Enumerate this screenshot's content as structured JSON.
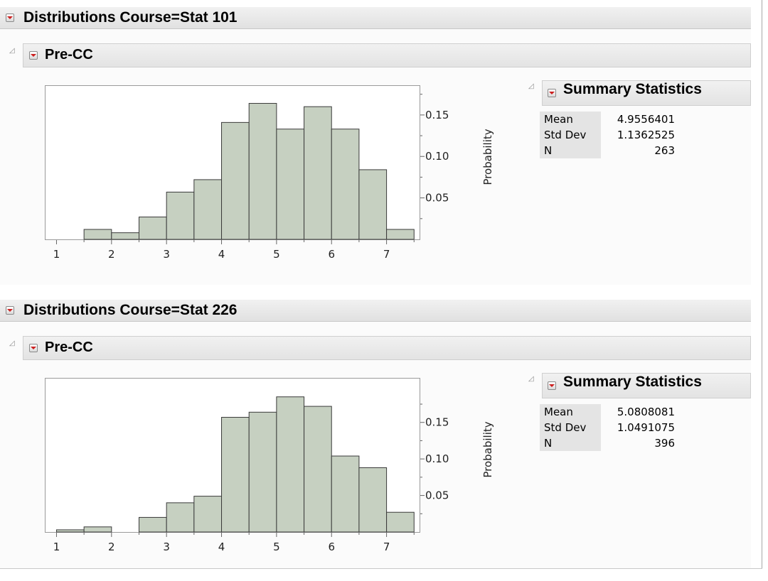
{
  "reports": [
    {
      "title": "Distributions Course=Stat 101",
      "variable": "Pre-CC",
      "summary_title": "Summary Statistics",
      "stats": [
        {
          "label": "Mean",
          "value": "4.9556401"
        },
        {
          "label": "Std Dev",
          "value": "1.1362525"
        },
        {
          "label": "N",
          "value": "263"
        }
      ],
      "chart_data": {
        "type": "bar",
        "bin_edges": [
          1.5,
          2.0,
          2.5,
          3.0,
          3.5,
          4.0,
          4.5,
          5.0,
          5.5,
          6.0,
          6.5,
          7.0,
          7.5
        ],
        "values": [
          0.012,
          0.008,
          0.027,
          0.057,
          0.072,
          0.141,
          0.164,
          0.133,
          0.16,
          0.133,
          0.084,
          0.012
        ],
        "xlim": [
          0.8,
          7.6
        ],
        "ylim": [
          0,
          0.185
        ],
        "x_ticks": [
          "1",
          "2",
          "3",
          "4",
          "5",
          "6",
          "7"
        ],
        "y_ticks": [
          "0.05",
          "0.10",
          "0.15"
        ],
        "ylabel": "Probability"
      }
    },
    {
      "title": "Distributions Course=Stat 226",
      "variable": "Pre-CC",
      "summary_title": "Summary Statistics",
      "stats": [
        {
          "label": "Mean",
          "value": "5.0808081"
        },
        {
          "label": "Std Dev",
          "value": "1.0491075"
        },
        {
          "label": "N",
          "value": "396"
        }
      ],
      "chart_data": {
        "type": "bar",
        "bin_edges": [
          1.0,
          1.5,
          2.0,
          2.5,
          3.0,
          3.5,
          4.0,
          4.5,
          5.0,
          5.5,
          6.0,
          6.5,
          7.0,
          7.5
        ],
        "values": [
          0.003,
          0.007,
          0.0,
          0.02,
          0.04,
          0.049,
          0.157,
          0.164,
          0.185,
          0.172,
          0.104,
          0.088,
          0.027
        ],
        "xlim": [
          0.8,
          7.6
        ],
        "ylim": [
          0,
          0.21
        ],
        "x_ticks": [
          "1",
          "2",
          "3",
          "4",
          "5",
          "6",
          "7"
        ],
        "y_ticks": [
          "0.05",
          "0.10",
          "0.15"
        ],
        "ylabel": "Probability"
      }
    }
  ]
}
